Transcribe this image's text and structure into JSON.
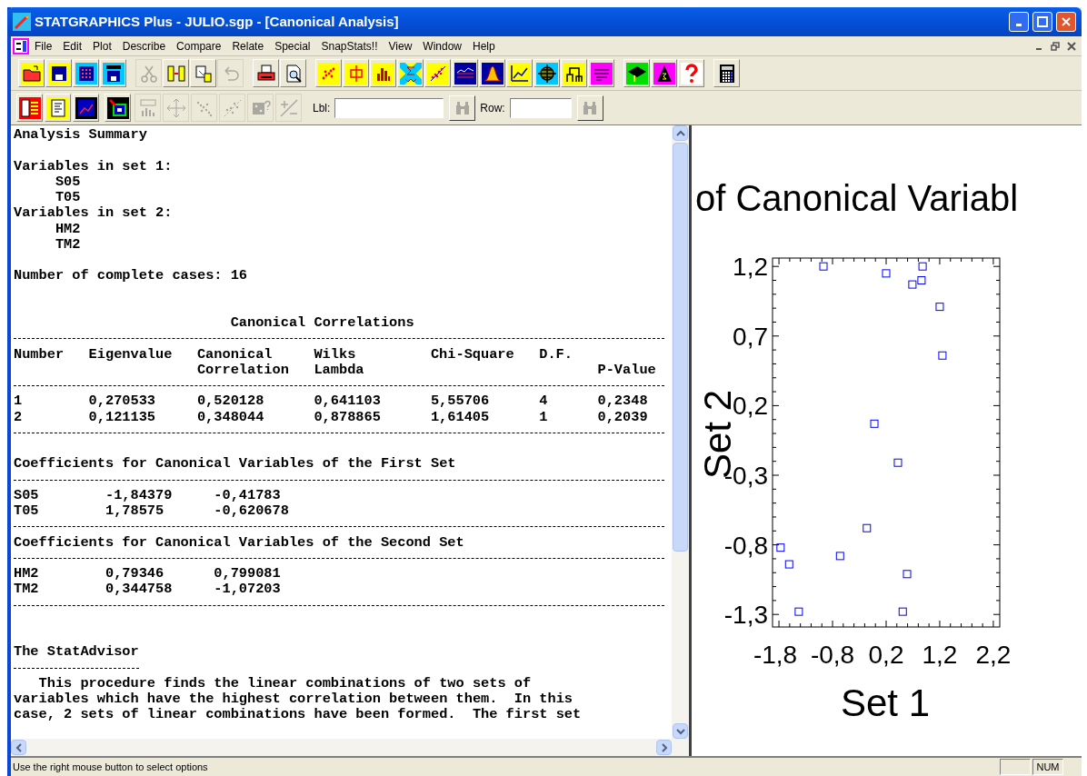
{
  "window": {
    "title": "STATGRAPHICS Plus - JULIO.sgp - [Canonical Analysis]"
  },
  "menu": [
    "File",
    "Edit",
    "Plot",
    "Describe",
    "Compare",
    "Relate",
    "Special",
    "SnapStats!!",
    "View",
    "Window",
    "Help"
  ],
  "toolbar_1": [
    {
      "disabled": false
    },
    {
      "disabled": false
    },
    {
      "disabled": false
    },
    {
      "disabled": false
    },
    {
      "disabled": true
    },
    {
      "disabled": false
    },
    {
      "disabled": false
    },
    {
      "disabled": true
    },
    {
      "disabled": false
    },
    {
      "disabled": false
    },
    {
      "disabled": false
    },
    {
      "disabled": false
    },
    {
      "disabled": false
    },
    {
      "disabled": false
    },
    {
      "disabled": false
    },
    {
      "disabled": false
    },
    {
      "disabled": false
    },
    {
      "disabled": false
    },
    {
      "disabled": false
    },
    {
      "disabled": false
    },
    {
      "disabled": false
    },
    {
      "disabled": false
    },
    {
      "disabled": false
    },
    {
      "disabled": false
    },
    {
      "disabled": false
    }
  ],
  "toolbar_2": {
    "buttons": [
      {
        "disabled": false
      },
      {
        "disabled": false
      },
      {
        "disabled": false
      },
      {
        "disabled": false
      },
      {
        "disabled": true
      },
      {
        "disabled": true
      },
      {
        "disabled": true
      },
      {
        "disabled": true
      },
      {
        "disabled": true
      },
      {
        "disabled": true
      }
    ],
    "label_field": {
      "label": "Lbl:"
    },
    "row_field": {
      "label": "Row:"
    }
  },
  "report": {
    "heading": "Analysis Summary",
    "variable_sets": [
      {
        "label": "Variables in set 1:",
        "variables": [
          "S05",
          "T05"
        ]
      },
      {
        "label": "Variables in set 2:",
        "variables": [
          "HM2",
          "TM2"
        ]
      }
    ],
    "cases": "Number of complete cases: 16",
    "correlations": {
      "title": "Canonical Correlations",
      "columns": [
        {
          "top": "Number"
        },
        {
          "top": "Eigenvalue"
        },
        {
          "top": "Canonical",
          "bottom": "Correlation"
        },
        {
          "top": "Wilks",
          "bottom": "Lambda"
        },
        {
          "top": "Chi-Square"
        },
        {
          "top": "D.F."
        },
        {
          "bottom": "P-Value"
        }
      ],
      "rows": [
        [
          "1",
          "0,270533",
          "0,520128",
          "0,641103",
          "5,55706",
          "4",
          "0,2348"
        ],
        [
          "2",
          "0,121135",
          "0,348044",
          "0,878865",
          "1,61405",
          "1",
          "0,2039"
        ]
      ]
    },
    "coefficient_tables": [
      {
        "title": "Coefficients for Canonical Variables of the First Set",
        "rows": [
          [
            "S05",
            "-1,84379",
            "-0,41783"
          ],
          [
            "T05",
            "1,78575",
            "-0,620678"
          ]
        ]
      },
      {
        "title": "Coefficients for Canonical Variables of the Second Set",
        "rows": [
          [
            "HM2",
            "0,79346",
            "0,799081"
          ],
          [
            "TM2",
            "0,344758",
            "-1,07203"
          ]
        ]
      }
    ],
    "advisor": {
      "title": "The StatAdvisor",
      "lines": [
        "   This procedure finds the linear combinations of two sets of",
        "variables which have the highest correlation between them.  In this",
        "case, 2 sets of linear combinations have been formed.  The first set"
      ]
    }
  },
  "graph": {
    "chart_data": {
      "type": "scatter",
      "title": "of Canonical Variabl",
      "xlabel": "Set 1",
      "ylabel": "Set 2",
      "x": [
        -0.97,
        0.2,
        0.88,
        0.86,
        0.69,
        1.2,
        1.25,
        -0.02,
        0.42,
        -0.16,
        -1.77,
        -1.61,
        -0.66,
        0.59,
        -1.43,
        0.51
      ],
      "series": [
        {
          "color": "#0000ff",
          "values": [
            1.2,
            1.15,
            1.2,
            1.1,
            1.07,
            0.91,
            0.56,
            0.07,
            -0.21,
            -0.68,
            -0.82,
            -0.94,
            -0.88,
            -1.01,
            -1.28,
            -1.28
          ]
        }
      ],
      "xlim": [
        -1.92,
        2.32
      ],
      "ylim": [
        -1.39,
        1.26
      ],
      "xticks": [
        {
          "value": -1.8,
          "label": "-1,8"
        },
        {
          "value": -0.8,
          "label": "-0,8"
        },
        {
          "value": 0.2,
          "label": "0,2"
        },
        {
          "value": 1.2,
          "label": "1,2"
        },
        {
          "value": 2.2,
          "label": "2,2"
        }
      ],
      "yticks": [
        {
          "value": 1.2,
          "label": "1,2"
        },
        {
          "value": 0.7,
          "label": "0,7"
        },
        {
          "value": 0.2,
          "label": "0,2"
        },
        {
          "value": -0.3,
          "label": "-0,3"
        },
        {
          "value": -0.8,
          "label": "-0,8"
        },
        {
          "value": -1.3,
          "label": "-1,3"
        }
      ]
    }
  },
  "status_bar": {
    "message": "Use the right mouse button to select options",
    "indicators": [
      "NUM"
    ]
  }
}
